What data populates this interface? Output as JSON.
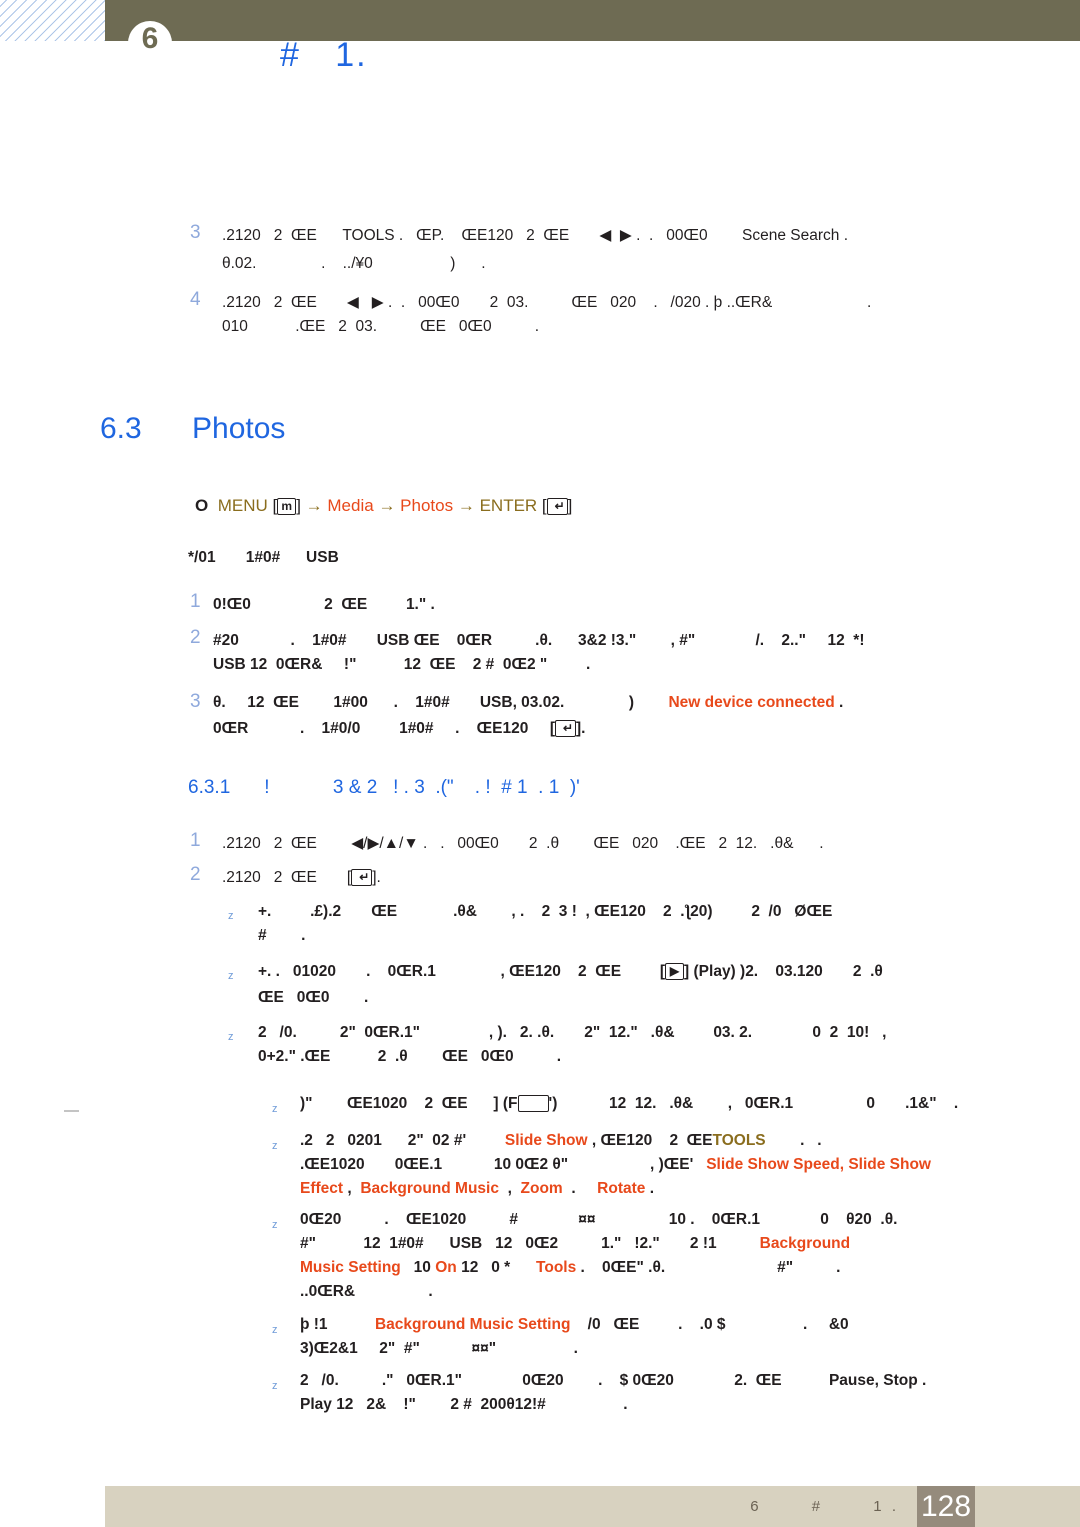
{
  "header": {
    "chapter_badge": "6",
    "title": "#   1."
  },
  "body": {
    "top_steps": [
      {
        "number": "3",
        "lines": [
          ".2120   2  ŒE      TOOLS .   ŒP.    ŒE120   2  ŒE       ◀  ▶ .  .   00Œ0        Scene Search .",
          "θ.02.               .    ../¥0                  )      ."
        ]
      },
      {
        "number": "4",
        "lines": [
          ".2120   2  ŒE       ◀   ▶ .  .   00Œ0       2  03.          ŒE   020    .   /020 . þ ..ŒR&                      .",
          "010           .ŒE   2  03.          ŒE   0Œ0          ."
        ]
      }
    ],
    "section": {
      "number": "6.3",
      "title": "Photos"
    },
    "navpath": {
      "marker": "O",
      "menu_label": "MENU",
      "menu_key": "m",
      "arrow": "→",
      "item1": "Media",
      "item2": "Photos",
      "enter_label": "ENTER",
      "enter_key": "↵"
    },
    "note_line": "*/01       1#0#      USB",
    "photo_steps": [
      {
        "number": "1",
        "lines": [
          "0!Œ0                 2  ŒE         1.\" ."
        ]
      },
      {
        "number": "2",
        "lines": [
          "#20            .    1#0#       USB ŒE    0ŒR          .θ.      3&2 !3.\"        , #\"              /.    2..\"     12  *!",
          "USB 12  0ŒR&     !\"           12  ŒE    2 #  0Œ2 \"         ."
        ]
      },
      {
        "number": "3",
        "lines_rich": true,
        "line1_pre": "θ.     12  ŒE        1#00      .    1#0#       USB, 03.02.               )        ",
        "line1_red": "New device connected",
        "line1_post": " .",
        "line2_pre": "0ŒR            .    1#0/0         1#0#     .    ŒE120     [",
        "line2_key": "↵",
        "line2_post": "]."
      }
    ],
    "subsection": {
      "number": "6.3.1",
      "title": "!            3 & 2   ! . 3  .(\"    . !  # 1  . 1  )'"
    },
    "sub_steps": [
      {
        "number": "1",
        "line_pre": ".2120   2  ŒE        ◀/▶/▲/▼ .   .   00Œ0       2  .θ        ŒE   020    .ŒE   2  12.   .θ&      ."
      },
      {
        "number": "2",
        "line_pre": ".2120   2  ŒE       [",
        "line_key": "↵",
        "line_post": "]."
      }
    ],
    "bullets_level1": [
      {
        "lines": [
          "+.         .£).2       ŒE             .θ&        , .    2  3 !  , ŒE120    2  .ƪ20)         2  /0   ØŒE",
          "#        ."
        ]
      },
      {
        "rich": true,
        "line1_pre": "+. .   01020       .    0ŒR.1               , ŒE120    2  ŒE         [",
        "line1_key": "▶",
        "line1_mid": "] (Play) )2.    03.120       2  .θ",
        "line2": "ŒE   0Œ0        ."
      },
      {
        "lines": [
          "2   /0.          2\"  0ŒR.1\"                , ).   2. .θ.       2\"  12.\"   .θ&         03. 2.              0  2  10!   ,",
          "0+2.\" .ŒE           2  .θ        ŒE   0Œ0          ."
        ]
      }
    ],
    "bullets_level2": [
      {
        "rich": true,
        "line1_pre": ")\"        ŒE1020    2  ŒE      ] (F",
        "line1_box": true,
        "line1_post": "')            12  12.   .θ&        ,   0ŒR.1                 0       .1&\"    .",
        "lines": []
      },
      {
        "rich": true,
        "line1_pre": ".2   2   0201      2\"  02 #'         ",
        "line1_red1": "Slide Show",
        "line1_mid": " , ŒE120    2  ŒE",
        "line1_gold": "TOOLS",
        "line1_post": "        .   .",
        "line2_pre": ".ŒE1020       0ŒE.1            10 0Œ2 θ\"                   , )ŒE'   ",
        "line2_red": "Slide Show Speed, Slide Show",
        "line3_red": "Effect",
        "line3_mid": " ,  ",
        "line3_red2": "Background Music",
        "line3_mid2": "  ,  ",
        "line3_red3": "Zoom",
        "line3_mid3": "  .     ",
        "line3_red4": "Rotate",
        "line3_post": " ."
      },
      {
        "rich": true,
        "line1": "0Œ20          .    ŒE1020          #              ¤¤                 10 .    0ŒR.1              0    θ20  .θ.",
        "line2_pre": "#\"           12  1#0#      USB   12   0Œ2          1.\"   !2.\"       2 !1          ",
        "line2_red": "Background",
        "line3_red1": "Music Setting",
        "line3_mid1": "   10 ",
        "line3_red2": "On",
        "line3_mid2": " 12   0 *      ",
        "line3_red3": "Tools",
        "line3_post": " .    0ŒE\" .θ.                          #\"          .",
        "line4": "..0ŒR&                 ."
      },
      {
        "rich": true,
        "line1_pre": "þ !1           ",
        "line1_red": "Background Music Setting",
        "line1_post": "    /0   ŒE         .    .0 $                  .     &0",
        "line2": "3)Œ2&1     2\"  #\"            ¤¤\"                  ."
      },
      {
        "rich": true,
        "line1_pre": "2   /0.          .\"   0ŒR.1\"              0Œ20        .    $ 0Œ20              2.  ŒE           ",
        "line1_dark": "Pause, Stop",
        "line1_post": " .",
        "line2_pre": "Play 12   2&    !\"        2 #  200θ12!#                  ."
      }
    ]
  },
  "footer": {
    "text": "6       #       1 .",
    "page_number": "128"
  }
}
